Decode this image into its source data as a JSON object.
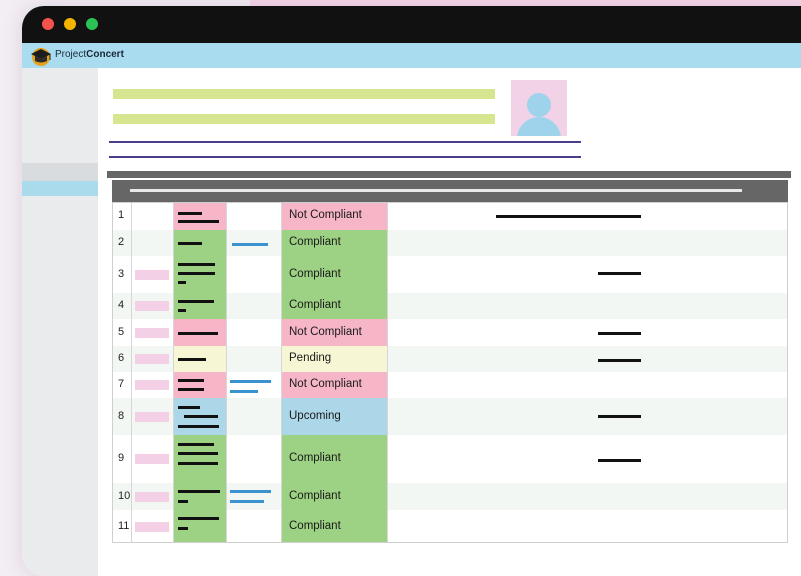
{
  "window": {
    "controls": [
      "close",
      "minimize",
      "maximize"
    ]
  },
  "app": {
    "brand_prefix": "Project",
    "brand_suffix": "Concert",
    "logo": "graduation-cap-icon"
  },
  "profile": {
    "avatar": "user-silhouette"
  },
  "colors": {
    "compliant": "#9dd184",
    "not_compliant": "#f6b6c7",
    "pending": "#f7f6d4",
    "upcoming": "#acd7e9",
    "header": "#666666",
    "appbar": "#a8dcee"
  },
  "table": {
    "rows": [
      {
        "num": "1",
        "status": "Not Compliant",
        "kind": "not_compliant"
      },
      {
        "num": "2",
        "status": "Compliant",
        "kind": "compliant"
      },
      {
        "num": "3",
        "status": "Compliant",
        "kind": "compliant"
      },
      {
        "num": "4",
        "status": "Compliant",
        "kind": "compliant"
      },
      {
        "num": "5",
        "status": "Not Compliant",
        "kind": "not_compliant"
      },
      {
        "num": "6",
        "status": "Pending",
        "kind": "pending"
      },
      {
        "num": "7",
        "status": "Not Compliant",
        "kind": "not_compliant"
      },
      {
        "num": "8",
        "status": "Upcoming",
        "kind": "upcoming"
      },
      {
        "num": "9",
        "status": "Compliant",
        "kind": "compliant"
      },
      {
        "num": "10",
        "status": "Compliant",
        "kind": "compliant"
      },
      {
        "num": "11",
        "status": "Compliant",
        "kind": "compliant"
      }
    ]
  }
}
